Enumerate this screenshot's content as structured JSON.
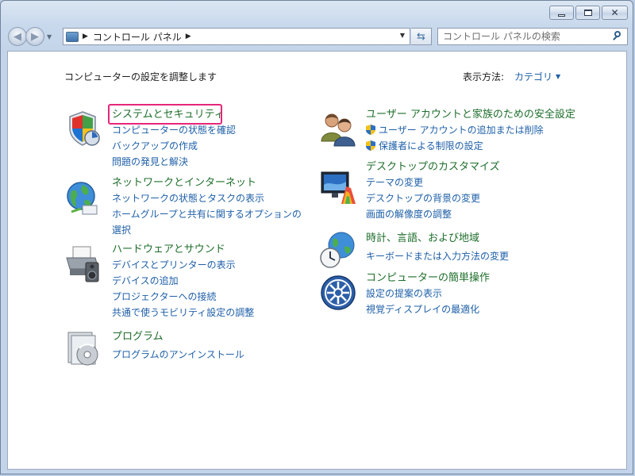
{
  "window": {
    "controls": {
      "minimize": "minimize",
      "maximize": "maximize",
      "close": "close"
    }
  },
  "nav": {
    "back_icon": "back-arrow-icon",
    "forward_icon": "forward-arrow-icon"
  },
  "address": {
    "crumb": "コントロール パネル",
    "icon": "control-panel-icon"
  },
  "search": {
    "placeholder": "コントロール パネルの検索"
  },
  "header": {
    "title": "コンピューターの設定を調整します",
    "view_by_label": "表示方法:",
    "view_by_value": "カテゴリ"
  },
  "categories": [
    {
      "heading": "システムとセキュリティ",
      "icon": "shield-icon",
      "links": [
        "コンピューターの状態を確認",
        "バックアップの作成",
        "問題の発見と解決"
      ]
    },
    {
      "heading": "ネットワークとインターネット",
      "icon": "network-globe-icon",
      "links": [
        "ネットワークの状態とタスクの表示",
        "ホームグループと共有に関するオプションの選択"
      ]
    },
    {
      "heading": "ハードウェアとサウンド",
      "icon": "printer-speaker-icon",
      "links": [
        "デバイスとプリンターの表示",
        "デバイスの追加",
        "プロジェクターへの接続",
        "共通で使うモビリティ設定の調整"
      ]
    },
    {
      "heading": "プログラム",
      "icon": "programs-disc-icon",
      "links": [
        "プログラムのアンインストール"
      ]
    },
    {
      "heading": "ユーザー アカウントと家族のための安全設定",
      "icon": "users-icon",
      "links": [
        "ユーザー アカウントの追加または削除",
        "保護者による制限の設定"
      ]
    },
    {
      "heading": "デスクトップのカスタマイズ",
      "icon": "monitor-paint-icon",
      "links": [
        "テーマの変更",
        "デスクトップの背景の変更",
        "画面の解像度の調整"
      ]
    },
    {
      "heading": "時計、言語、および地域",
      "icon": "clock-globe-icon",
      "links": [
        "キーボードまたは入力方法の変更"
      ]
    },
    {
      "heading": "コンピューターの簡単操作",
      "icon": "ease-of-access-icon",
      "links": [
        "設定の提案の表示",
        "視覚ディスプレイの最適化"
      ]
    }
  ],
  "colors": {
    "heading": "#1e6e2b",
    "link": "#1e5fa8",
    "highlight": "#e6267a"
  }
}
